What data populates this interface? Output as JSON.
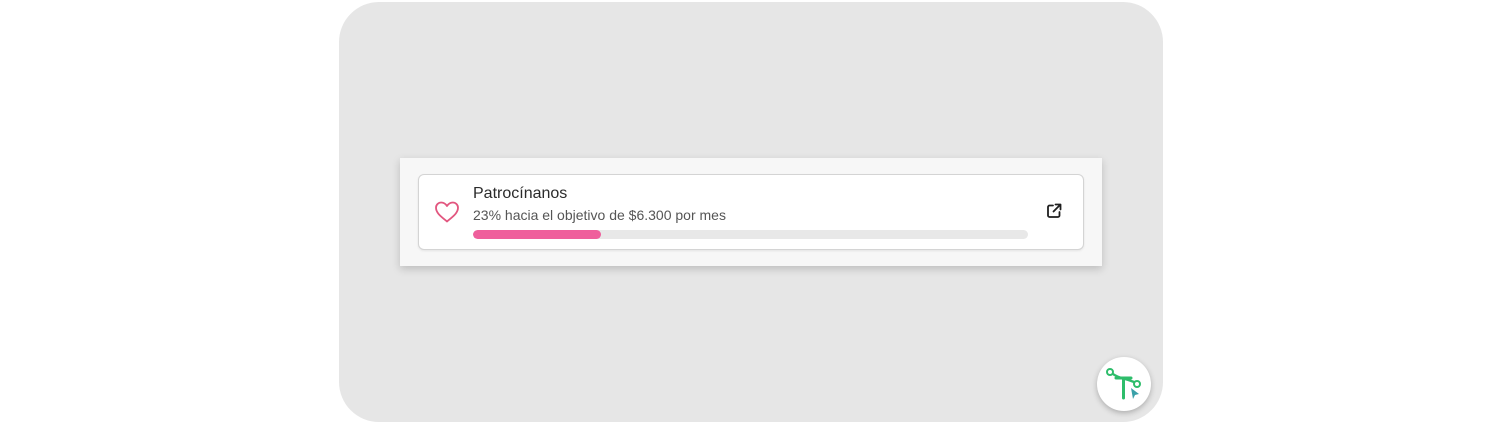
{
  "sponsors": {
    "title": "Patrocínanos",
    "goal_text": "23% hacia el objetivo de $6.300 por mes",
    "progress_fraction": 0.23,
    "accent_color": "#ef5f9c",
    "icon": "heart-icon",
    "link_icon": "external-link-icon"
  },
  "fab": {
    "icon": "tool-logo-icon",
    "colors": [
      "#2ebd6b",
      "#3aa0a8"
    ]
  }
}
